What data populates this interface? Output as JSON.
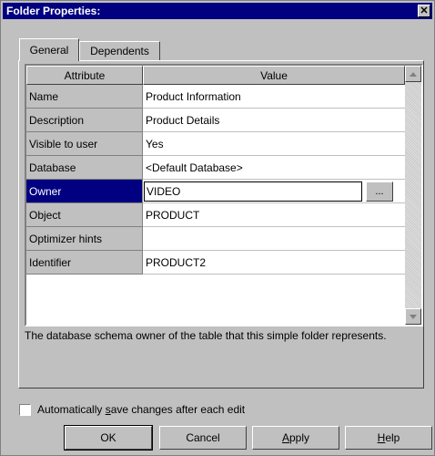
{
  "window": {
    "title": "Folder Properties:"
  },
  "tabs": [
    {
      "label": "General"
    },
    {
      "label": "Dependents"
    }
  ],
  "grid": {
    "headers": {
      "attribute": "Attribute",
      "value": "Value"
    },
    "rows": [
      {
        "name": "Name",
        "value": "Product Information"
      },
      {
        "name": "Description",
        "value": "Product Details"
      },
      {
        "name": "Visible to user",
        "value": "Yes"
      },
      {
        "name": "Database",
        "value": "<Default Database>"
      },
      {
        "name": "Owner",
        "value": "VIDEO"
      },
      {
        "name": "Object",
        "value": "PRODUCT"
      },
      {
        "name": "Optimizer hints",
        "value": ""
      },
      {
        "name": "Identifier",
        "value": "PRODUCT2"
      }
    ],
    "selected_row": "Owner",
    "ellipsis_label": "..."
  },
  "description": "The database schema owner of the table that this simple folder represents.",
  "autosave": {
    "label_pre": "Automatically ",
    "label_accel": "s",
    "label_post": "ave changes after each edit",
    "checked": false
  },
  "buttons": {
    "ok": "OK",
    "cancel": "Cancel",
    "apply_accel": "A",
    "apply_rest": "pply",
    "help_accel": "H",
    "help_rest": "elp"
  },
  "colors": {
    "titlebar": "#000080",
    "face": "#c0c0c0",
    "selection": "#000080"
  }
}
